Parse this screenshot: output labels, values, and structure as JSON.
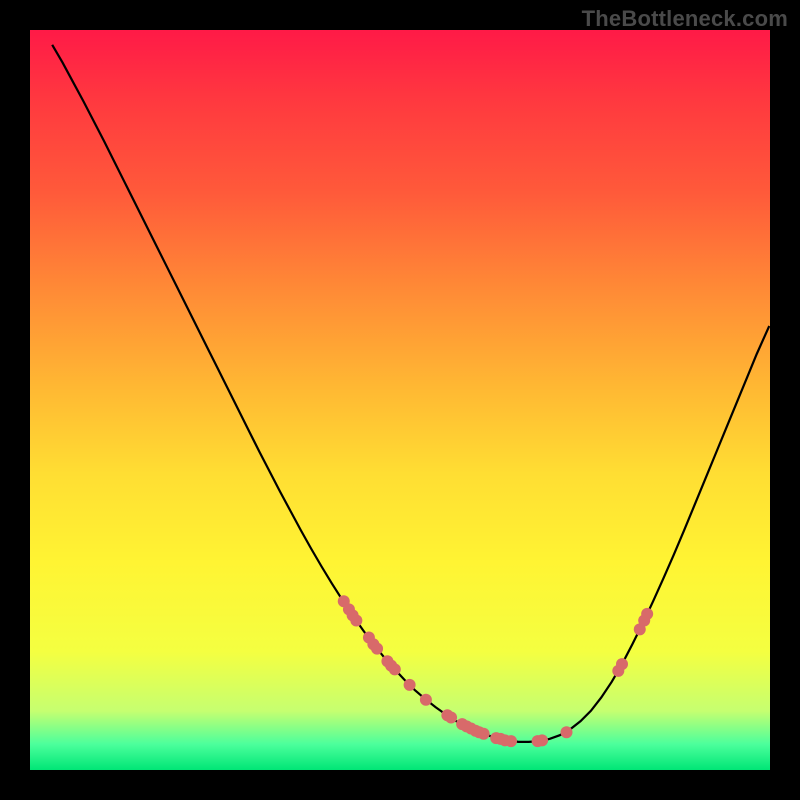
{
  "watermark": "TheBottleneck.com",
  "chart_data": {
    "type": "line",
    "title": "",
    "xlabel": "",
    "ylabel": "",
    "xlim": [
      0,
      100
    ],
    "ylim": [
      0,
      100
    ],
    "curve": [
      {
        "x": 3.0,
        "y": 98.0
      },
      {
        "x": 4.4,
        "y": 95.6
      },
      {
        "x": 5.8,
        "y": 93.0
      },
      {
        "x": 7.2,
        "y": 90.4
      },
      {
        "x": 8.6,
        "y": 87.7
      },
      {
        "x": 10.0,
        "y": 85.0
      },
      {
        "x": 11.4,
        "y": 82.2
      },
      {
        "x": 12.8,
        "y": 79.4
      },
      {
        "x": 14.2,
        "y": 76.6
      },
      {
        "x": 15.6,
        "y": 73.8
      },
      {
        "x": 17.0,
        "y": 71.0
      },
      {
        "x": 18.4,
        "y": 68.2
      },
      {
        "x": 19.8,
        "y": 65.4
      },
      {
        "x": 21.2,
        "y": 62.6
      },
      {
        "x": 22.6,
        "y": 59.8
      },
      {
        "x": 24.0,
        "y": 57.0
      },
      {
        "x": 25.4,
        "y": 54.2
      },
      {
        "x": 26.8,
        "y": 51.4
      },
      {
        "x": 28.2,
        "y": 48.6
      },
      {
        "x": 29.6,
        "y": 45.8
      },
      {
        "x": 31.0,
        "y": 43.0
      },
      {
        "x": 32.4,
        "y": 40.3
      },
      {
        "x": 33.8,
        "y": 37.6
      },
      {
        "x": 35.2,
        "y": 35.0
      },
      {
        "x": 36.6,
        "y": 32.4
      },
      {
        "x": 38.0,
        "y": 29.9
      },
      {
        "x": 39.4,
        "y": 27.5
      },
      {
        "x": 40.8,
        "y": 25.2
      },
      {
        "x": 42.2,
        "y": 23.0
      },
      {
        "x": 43.6,
        "y": 20.9
      },
      {
        "x": 45.0,
        "y": 18.9
      },
      {
        "x": 46.4,
        "y": 17.0
      },
      {
        "x": 47.8,
        "y": 15.3
      },
      {
        "x": 49.2,
        "y": 13.7
      },
      {
        "x": 50.6,
        "y": 12.2
      },
      {
        "x": 52.0,
        "y": 10.8
      },
      {
        "x": 53.4,
        "y": 9.6
      },
      {
        "x": 54.8,
        "y": 8.5
      },
      {
        "x": 56.2,
        "y": 7.5
      },
      {
        "x": 57.6,
        "y": 6.6
      },
      {
        "x": 59.0,
        "y": 5.9
      },
      {
        "x": 60.4,
        "y": 5.2
      },
      {
        "x": 61.8,
        "y": 4.7
      },
      {
        "x": 63.2,
        "y": 4.3
      },
      {
        "x": 64.6,
        "y": 4.0
      },
      {
        "x": 66.0,
        "y": 3.8
      },
      {
        "x": 67.4,
        "y": 3.8
      },
      {
        "x": 68.8,
        "y": 3.9
      },
      {
        "x": 70.2,
        "y": 4.2
      },
      {
        "x": 71.6,
        "y": 4.7
      },
      {
        "x": 73.0,
        "y": 5.5
      },
      {
        "x": 74.4,
        "y": 6.6
      },
      {
        "x": 75.8,
        "y": 8.0
      },
      {
        "x": 77.2,
        "y": 9.8
      },
      {
        "x": 78.6,
        "y": 11.9
      },
      {
        "x": 80.0,
        "y": 14.3
      },
      {
        "x": 81.4,
        "y": 17.0
      },
      {
        "x": 82.8,
        "y": 19.8
      },
      {
        "x": 84.2,
        "y": 22.8
      },
      {
        "x": 85.6,
        "y": 25.9
      },
      {
        "x": 87.0,
        "y": 29.1
      },
      {
        "x": 88.4,
        "y": 32.4
      },
      {
        "x": 89.8,
        "y": 35.8
      },
      {
        "x": 91.2,
        "y": 39.2
      },
      {
        "x": 92.6,
        "y": 42.6
      },
      {
        "x": 94.0,
        "y": 46.0
      },
      {
        "x": 95.4,
        "y": 49.4
      },
      {
        "x": 96.8,
        "y": 52.8
      },
      {
        "x": 98.2,
        "y": 56.2
      },
      {
        "x": 99.9,
        "y": 60.0
      }
    ],
    "points": [
      {
        "x": 42.4,
        "y": 22.8
      },
      {
        "x": 43.1,
        "y": 21.7
      },
      {
        "x": 43.6,
        "y": 20.9
      },
      {
        "x": 44.1,
        "y": 20.2
      },
      {
        "x": 45.8,
        "y": 17.9
      },
      {
        "x": 46.4,
        "y": 17.0
      },
      {
        "x": 46.9,
        "y": 16.4
      },
      {
        "x": 48.3,
        "y": 14.7
      },
      {
        "x": 48.8,
        "y": 14.1
      },
      {
        "x": 49.3,
        "y": 13.6
      },
      {
        "x": 51.3,
        "y": 11.5
      },
      {
        "x": 53.5,
        "y": 9.5
      },
      {
        "x": 56.4,
        "y": 7.4
      },
      {
        "x": 56.9,
        "y": 7.1
      },
      {
        "x": 58.4,
        "y": 6.2
      },
      {
        "x": 59.0,
        "y": 5.9
      },
      {
        "x": 59.6,
        "y": 5.6
      },
      {
        "x": 60.2,
        "y": 5.3
      },
      {
        "x": 60.7,
        "y": 5.1
      },
      {
        "x": 61.3,
        "y": 4.9
      },
      {
        "x": 63.0,
        "y": 4.3
      },
      {
        "x": 63.6,
        "y": 4.2
      },
      {
        "x": 64.2,
        "y": 4.0
      },
      {
        "x": 65.0,
        "y": 3.9
      },
      {
        "x": 68.6,
        "y": 3.9
      },
      {
        "x": 69.2,
        "y": 4.0
      },
      {
        "x": 72.5,
        "y": 5.1
      },
      {
        "x": 79.5,
        "y": 13.4
      },
      {
        "x": 80.0,
        "y": 14.3
      },
      {
        "x": 82.4,
        "y": 19.0
      },
      {
        "x": 83.0,
        "y": 20.2
      },
      {
        "x": 83.4,
        "y": 21.1
      }
    ],
    "gradient_stops": [
      {
        "pos": 0.0,
        "color": "#ff1a47"
      },
      {
        "pos": 0.1,
        "color": "#ff3a3f"
      },
      {
        "pos": 0.22,
        "color": "#ff5a3a"
      },
      {
        "pos": 0.35,
        "color": "#ff8a36"
      },
      {
        "pos": 0.48,
        "color": "#ffb733"
      },
      {
        "pos": 0.6,
        "color": "#ffde33"
      },
      {
        "pos": 0.72,
        "color": "#fff433"
      },
      {
        "pos": 0.84,
        "color": "#f4ff41"
      },
      {
        "pos": 0.92,
        "color": "#c6ff70"
      },
      {
        "pos": 0.965,
        "color": "#4cff9c"
      },
      {
        "pos": 1.0,
        "color": "#00e676"
      }
    ],
    "curve_color": "#000000",
    "point_color": "#d86a6a",
    "point_radius_px": 6
  }
}
